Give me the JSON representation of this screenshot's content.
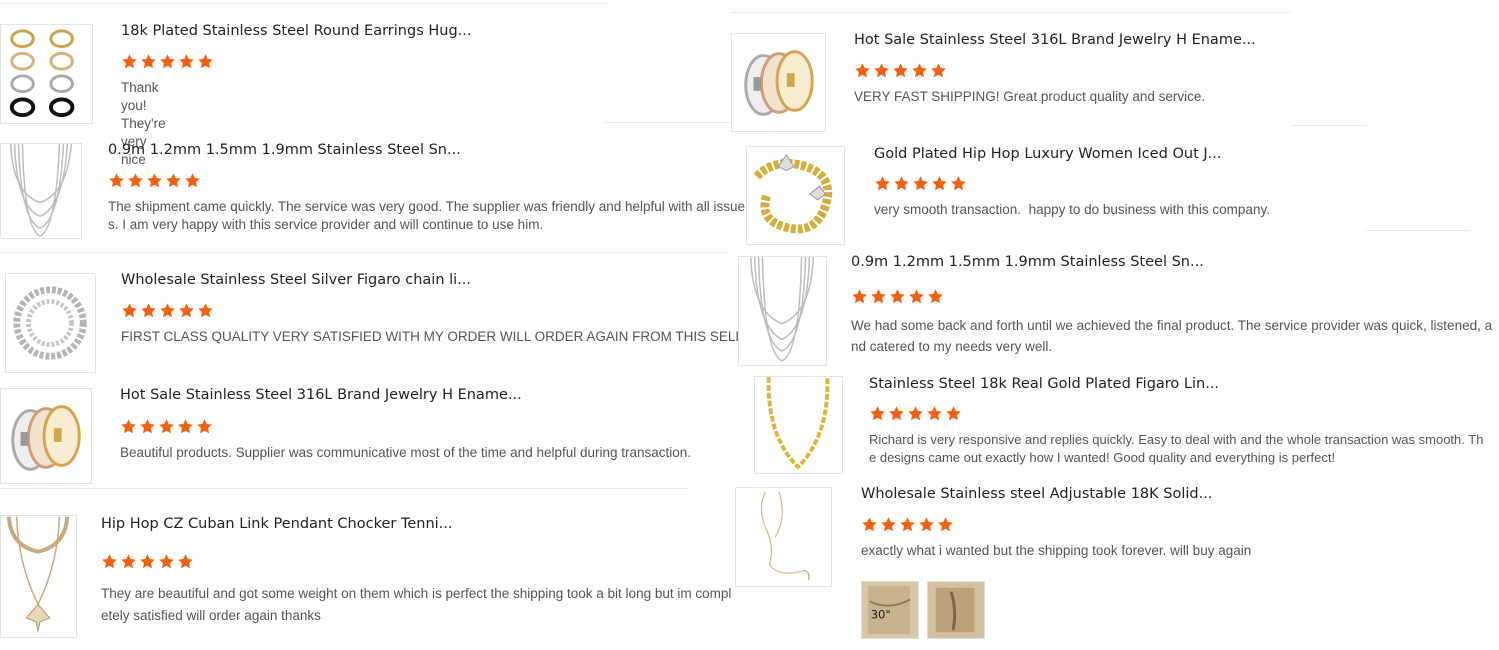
{
  "accent_star_color": "#f5600c",
  "left_reviews": [
    {
      "title": "18k Plated Stainless Steel Round Earrings Hug...",
      "rating": 5,
      "text": "Thank you! They're very nice",
      "thumb_icon": "hoop-earrings-icon"
    },
    {
      "title": "0.9m 1.2mm 1.5mm 1.9mm Stainless Steel Sn...",
      "rating": 5,
      "text": "The shipment came quickly. The service was very good. The supplier was friendly and helpful with all issues. I am very happy with this service provider and will continue to use him.",
      "text_line1": "The shipment came quickly. The service was very good. The supplier was friendly and helpful with all issue",
      "text_line2": "s. I am very happy with this service provider and will continue to use him.",
      "thumb_icon": "snake-chains-icon"
    },
    {
      "title": "Wholesale Stainless Steel Silver Figaro chain li...",
      "rating": 5,
      "text": "FIRST CLASS QUALITY VERY SATISFIED WITH MY ORDER WILL ORDER AGAIN FROM THIS SELLER",
      "thumb_icon": "silver-cuban-chain-icon"
    },
    {
      "title": "Hot Sale Stainless Steel 316L Brand Jewelry H Ename...",
      "rating": 5,
      "text": "Beautiful products. Supplier was communicative most of the time and helpful during transaction.",
      "thumb_icon": "h-bangles-icon"
    },
    {
      "title": "Hip Hop CZ Cuban Link Pendant Chocker Tenni...",
      "rating": 5,
      "text": "They are beautiful and got some weight on them which is perfect the shipping took a bit long but im completely satisfied will order again thanks",
      "text_line1": "They are beautiful and got some weight on them which is perfect the shipping took a bit long but im compl",
      "text_line2": "etely satisfied will order again thanks",
      "thumb_icon": "butterfly-pendant-icon"
    }
  ],
  "right_reviews": [
    {
      "title": "Hot Sale Stainless Steel 316L Brand Jewelry H Ename...",
      "rating": 5,
      "text": "VERY FAST SHIPPING! Great product quality and service.",
      "thumb_icon": "h-bangles-icon"
    },
    {
      "title": "Gold Plated Hip Hop Luxury Women Iced Out J...",
      "rating": 5,
      "text": "very smooth transaction.  happy to do business with this company.",
      "thumb_icon": "gold-butterfly-chain-icon"
    },
    {
      "title": "0.9m 1.2mm 1.5mm 1.9mm Stainless Steel Sn...",
      "rating": 5,
      "text": "We had some back and forth until we achieved the final product. The service provider was quick, listened, and catered to my needs very well.",
      "text_line1": "We had some back and forth until we achieved the final product. The service provider was quick, listened, a",
      "text_line2": "nd catered to my needs very well.",
      "thumb_icon": "snake-chains-icon"
    },
    {
      "title": "Stainless Steel 18k Real Gold Plated Figaro Lin...",
      "rating": 5,
      "text": "Richard is very responsive and replies quickly. Easy to deal with and the whole transaction was smooth. The designs came out exactly how I wanted! Good quality and everything is perfect!",
      "text_line1": "Richard is very responsive and replies quickly. Easy to deal with and the whole transaction was smooth. Th",
      "text_line2": "e designs came out exactly how I wanted! Good quality and everything is perfect!",
      "thumb_icon": "gold-figaro-chain-icon"
    },
    {
      "title": "Wholesale Stainless steel Adjustable 18K Solid...",
      "rating": 5,
      "text": "exactly what i wanted but the shipping took forever. will buy again",
      "thumb_icon": "gold-thin-chain-icon",
      "photo_icons": [
        "bag-photo-icon",
        "bag-photo-icon"
      ],
      "photo_label": "30\""
    }
  ]
}
